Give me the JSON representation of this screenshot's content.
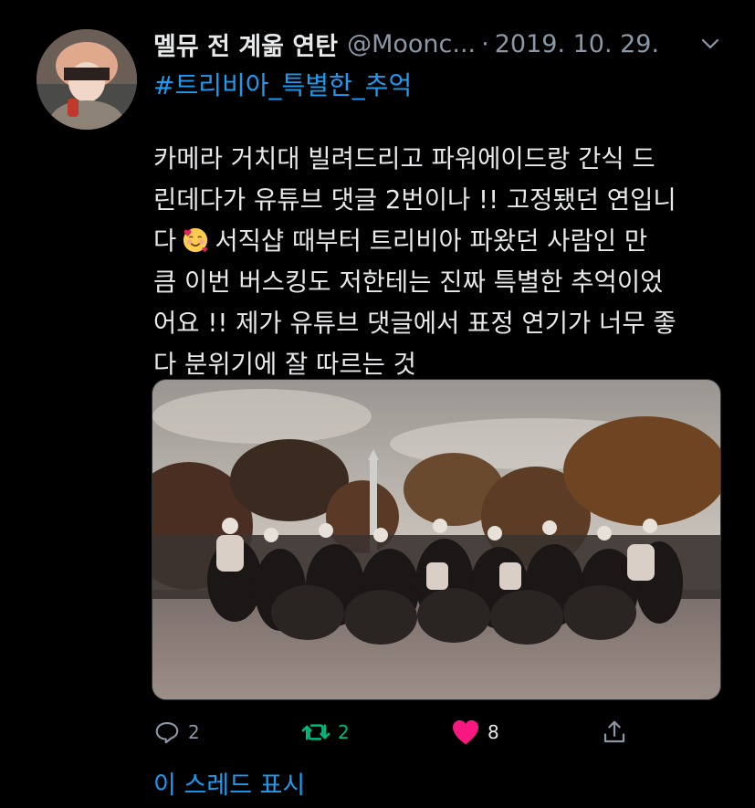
{
  "tweet": {
    "display_name": "멜뮤 전 계옮 연탄",
    "handle": "@Moonc...",
    "separator": "·",
    "date": "2019. 10. 29.",
    "hashtag": "#트리비아_특별한_추억",
    "body_lines": [
      "카메라 거치대 빌려드리고 파워에이드랑 간식 드",
      "린데다가 유튜브 댓글 2번이나 !! 고정됐던 연입니",
      "서직샵 때부터 트리비아 파왔던 사람인 만",
      "큼 이번 버스킹도 저한테는 진짜 특별한 추억이었",
      "어요 !! 제가 유튜브 댓글에서 표정 연기가 너무 좋",
      "다 분위기에 잘 따르는 것"
    ],
    "line3_prefix": "다",
    "emoji_name": "smiling-face-with-hearts-emoji"
  },
  "actions": {
    "reply_count": "2",
    "retweet_count": "2",
    "like_count": "8"
  },
  "thread_link": "이 스레드 표시",
  "colors": {
    "background": "#000000",
    "link": "#1d9bf0",
    "muted": "#8b98a5",
    "retweet": "#00ba7c",
    "like": "#f91880"
  }
}
